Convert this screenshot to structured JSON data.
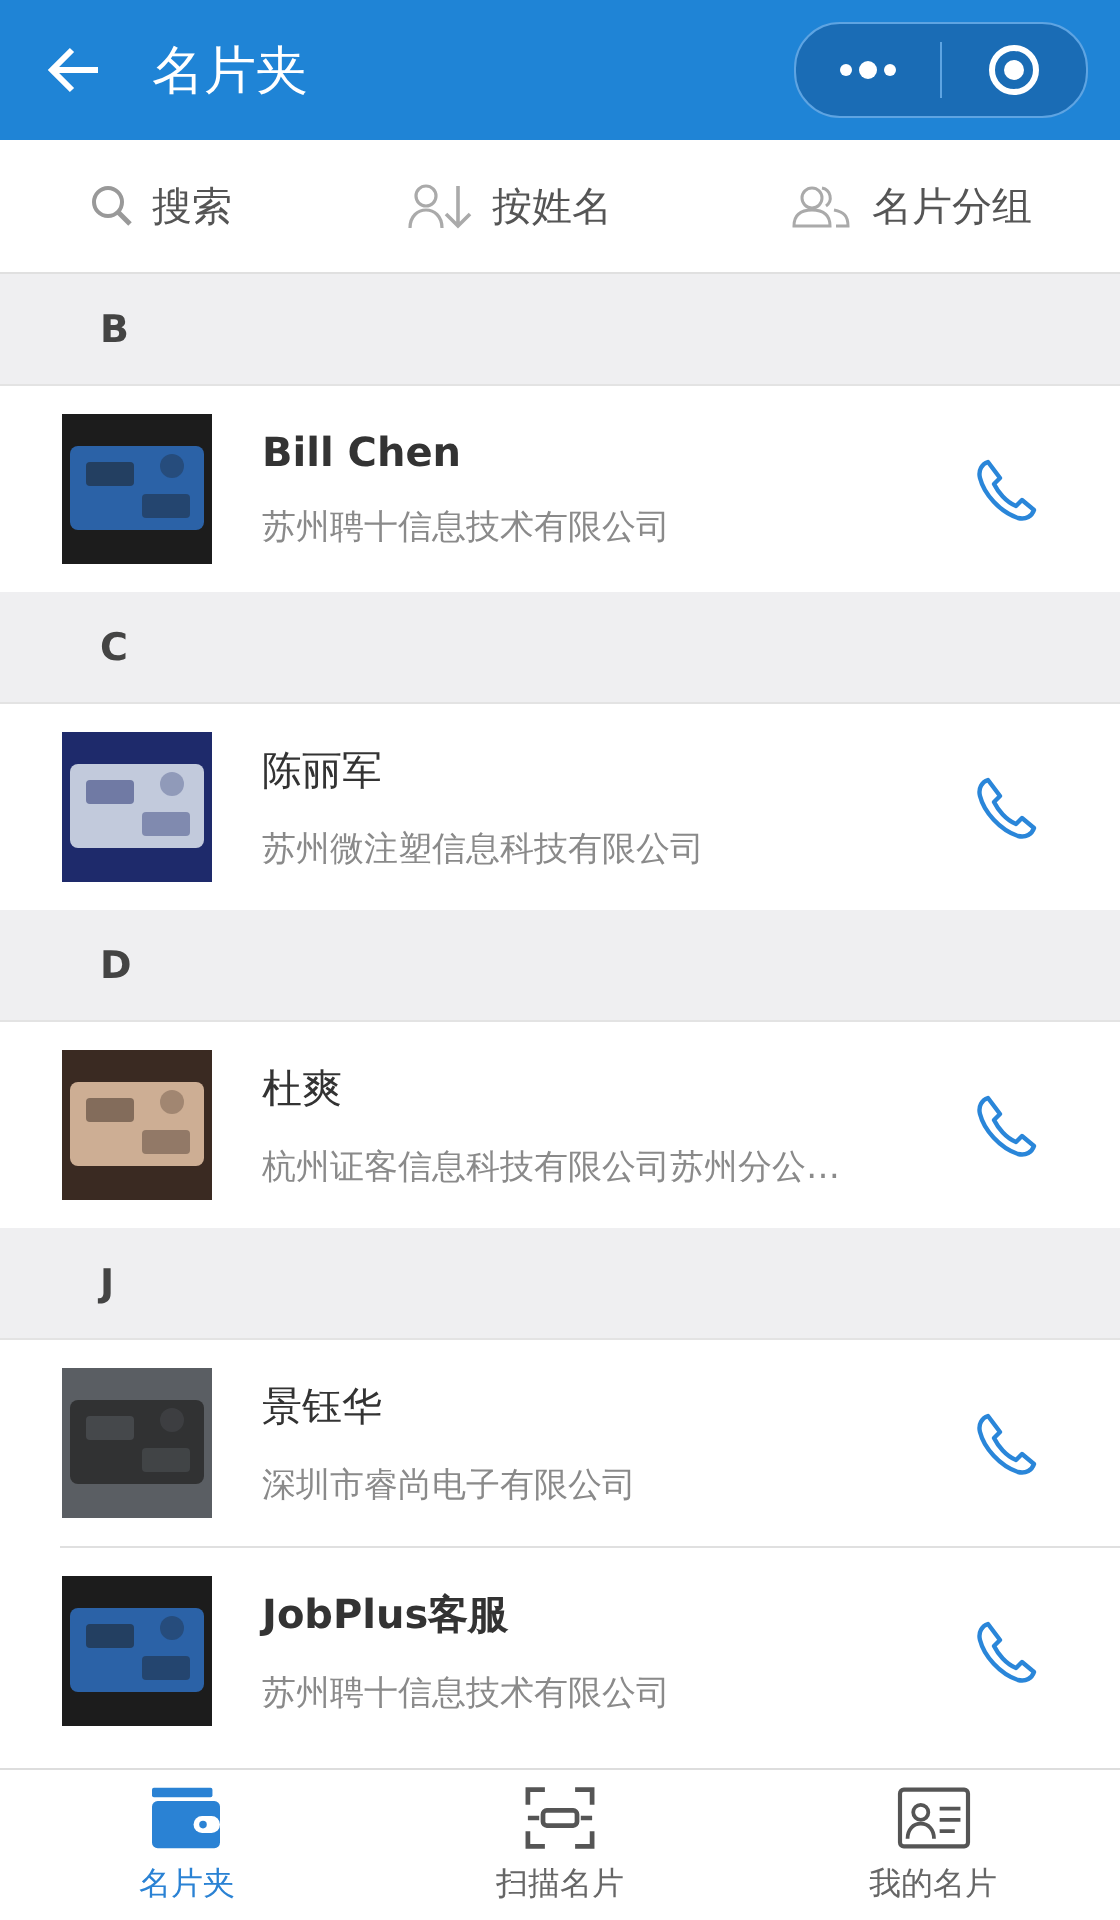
{
  "header": {
    "title": "名片夹"
  },
  "toolbar": [
    {
      "kind": "search",
      "label": "搜索"
    },
    {
      "kind": "sort",
      "label": "按姓名"
    },
    {
      "kind": "group",
      "label": "名片分组"
    }
  ],
  "sections": [
    {
      "letter": "B",
      "contacts": [
        {
          "name": "Bill Chen",
          "company": "苏州聘十信息技术有限公司"
        }
      ]
    },
    {
      "letter": "C",
      "contacts": [
        {
          "name": "陈丽军",
          "company": "苏州微注塑信息科技有限公司"
        }
      ]
    },
    {
      "letter": "D",
      "contacts": [
        {
          "name": "杜爽",
          "company": "杭州证客信息科技有限公司苏州分公…"
        }
      ]
    },
    {
      "letter": "J",
      "contacts": [
        {
          "name": "景钰华",
          "company": "深圳市睿尚电子有限公司"
        },
        {
          "name": "JobPlus客服",
          "company": "苏州聘十信息技术有限公司"
        }
      ]
    }
  ],
  "tabs": [
    {
      "kind": "cards",
      "label": "名片夹",
      "selected": true
    },
    {
      "kind": "scan",
      "label": "扫描名片",
      "selected": false
    },
    {
      "kind": "mine",
      "label": "我的名片",
      "selected": false
    }
  ]
}
